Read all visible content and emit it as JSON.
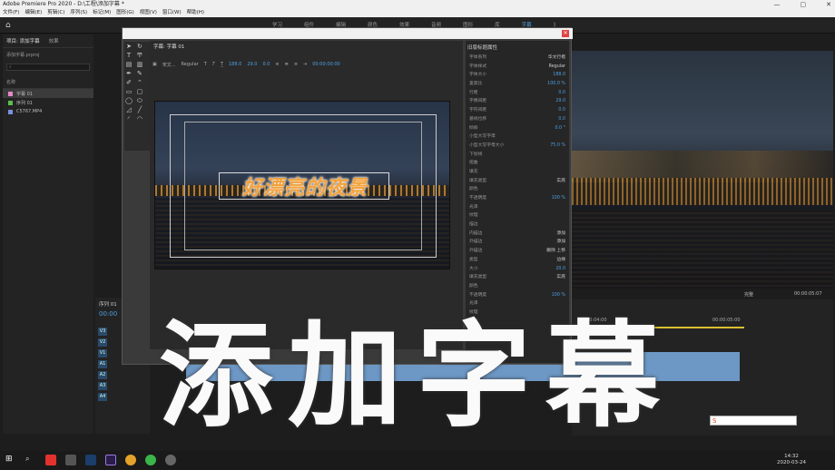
{
  "window": {
    "title": "Adobe Premiere Pro 2020 - D:\\工程\\添加字幕 *"
  },
  "menu": [
    "文件(F)",
    "编辑(E)",
    "剪辑(C)",
    "序列(S)",
    "标记(M)",
    "图形(G)",
    "视图(V)",
    "窗口(W)",
    "帮助(H)"
  ],
  "workspaces": [
    "学习",
    "组件",
    "编辑",
    "颜色",
    "效果",
    "音频",
    "图形",
    "库",
    "字幕",
    "》"
  ],
  "project": {
    "tabs": [
      "项目: 添加字幕",
      "效果"
    ],
    "file": "添加字幕.prproj",
    "header": "名称",
    "items": [
      {
        "label": "字幕 01",
        "color": "#e48ac8"
      },
      {
        "label": "序列 01",
        "color": "#5bbf4e"
      },
      {
        "label": "C5767.MP4",
        "color": "#7b8fe0"
      }
    ]
  },
  "dialog": {
    "tab": "字幕: 字幕 01",
    "toolbar": {
      "font": "宋文...",
      "style": "Regular",
      "size": "188.0",
      "kerning": "29.0",
      "leading": "0.0",
      "timecode": "00:00:00:00"
    },
    "subtitle": "好漂亮的夜景",
    "props": {
      "title": "旧版标题属性",
      "rows": [
        {
          "k": "字体系列",
          "v": "华文行楷"
        },
        {
          "k": "字体样式",
          "v": "Regular"
        },
        {
          "k": "字体大小",
          "v": "188.0"
        },
        {
          "k": "宽高比",
          "v": "100.0 %"
        },
        {
          "k": "行距",
          "v": "0.0"
        },
        {
          "k": "字偶间距",
          "v": "29.0"
        },
        {
          "k": "字符间距",
          "v": "0.0"
        },
        {
          "k": "基线位移",
          "v": "0.0"
        },
        {
          "k": "倾斜",
          "v": "0.0 °"
        },
        {
          "k": "小型大写字母",
          "v": ""
        },
        {
          "k": "小型大写字母大小",
          "v": "75.0 %"
        },
        {
          "k": "下划线",
          "v": ""
        },
        {
          "k": "扭曲",
          "v": ""
        },
        {
          "k": "填充",
          "v": ""
        },
        {
          "k": "填充类型",
          "v": "实底"
        },
        {
          "k": "颜色",
          "v": ""
        },
        {
          "k": "不透明度",
          "v": "100 %"
        },
        {
          "k": "光泽",
          "v": ""
        },
        {
          "k": "纹理",
          "v": ""
        },
        {
          "k": "描边",
          "v": ""
        },
        {
          "k": "内描边",
          "v": "添加"
        },
        {
          "k": "外描边",
          "v": "添加"
        },
        {
          "k": "外描边",
          "v": "删除  上移"
        },
        {
          "k": "类型",
          "v": "边缘"
        },
        {
          "k": "大小",
          "v": "20.0"
        },
        {
          "k": "填充类型",
          "v": "实底"
        },
        {
          "k": "颜色",
          "v": ""
        },
        {
          "k": "不透明度",
          "v": "100 %"
        },
        {
          "k": "光泽",
          "v": ""
        },
        {
          "k": "纹理",
          "v": ""
        },
        {
          "k": "阴影",
          "v": ""
        }
      ]
    }
  },
  "program": {
    "fit": "完整",
    "timecode": "00:00:05:07"
  },
  "timeline": {
    "tab": "序列 01",
    "timecode": "00:00",
    "ruler": [
      "00:00:04:00",
      "00:00:05:00"
    ],
    "tracks": [
      "V3",
      "V2",
      "V1",
      "A1",
      "A2",
      "A3",
      "A4"
    ]
  },
  "caption": "添加字幕",
  "clock": {
    "time": "14:32",
    "date": "2020-03-24"
  },
  "colors": {
    "accent": "#4e9fe0",
    "subtitle": "#f3a23c",
    "clip": "#6d98c6"
  }
}
